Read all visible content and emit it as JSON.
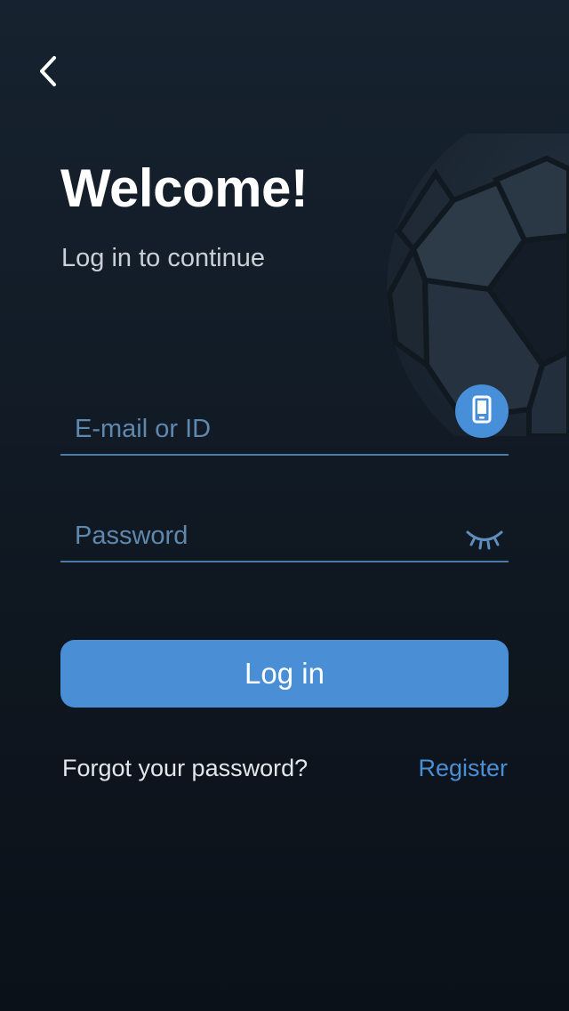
{
  "header": {
    "back_icon": "chevron-left-icon"
  },
  "main": {
    "title": "Welcome!",
    "subtitle": "Log in to continue"
  },
  "form": {
    "email_placeholder": "E-mail or ID",
    "email_value": "",
    "email_toggle_icon": "mobile-phone-icon",
    "password_placeholder": "Password",
    "password_value": "",
    "password_toggle_icon": "eye-closed-icon",
    "login_label": "Log in"
  },
  "footer": {
    "forgot_label": "Forgot your password?",
    "register_label": "Register"
  },
  "colors": {
    "accent": "#4a8fd6",
    "field_line": "#4d7ba6",
    "placeholder": "#5f88af",
    "background_top": "#16222f",
    "background_bottom": "#0b1119"
  },
  "decorations": {
    "background_icon": "soccer-ball-icon"
  }
}
